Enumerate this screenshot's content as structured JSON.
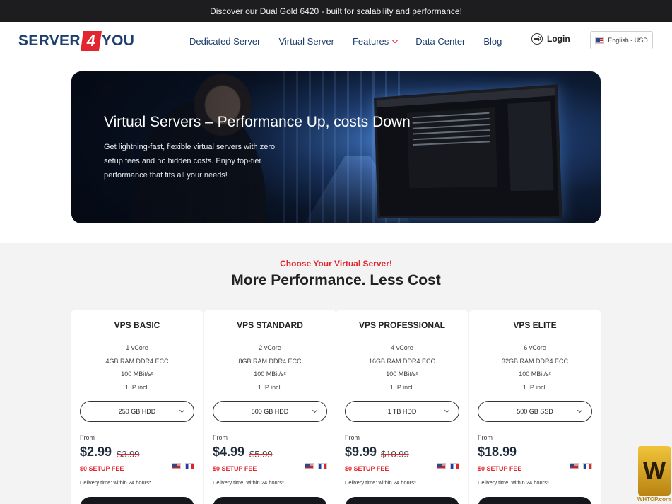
{
  "announcement": "Discover our Dual Gold 6420 - built for scalability and performance!",
  "logo": {
    "part1": "SERVER",
    "part2": "4",
    "part3": "YOU"
  },
  "nav": {
    "items": [
      "Dedicated Server",
      "Virtual Server",
      "Features",
      "Data Center",
      "Blog"
    ],
    "login": "Login",
    "language": "English - USD"
  },
  "hero": {
    "title": "Virtual Servers – Performance Up, costs Down",
    "text": "Get lightning-fast, flexible virtual servers with zero setup fees and no hidden costs. Enjoy top-tier performance that fits all your needs!"
  },
  "section": {
    "kicker": "Choose Your Virtual Server!",
    "title": "More Performance. Less Cost"
  },
  "plans": [
    {
      "name": "VPS BASIC",
      "specs": [
        "1 vCore",
        "4GB RAM DDR4 ECC",
        "100 MBit/s²",
        "1 IP incl."
      ],
      "storage": "250 GB HDD",
      "from": "From",
      "price": "$2.99",
      "old_price": "$3.99",
      "setup": "$0 SETUP FEE",
      "delivery": "Delivery time: within 24 hours*"
    },
    {
      "name": "VPS STANDARD",
      "specs": [
        "2 vCore",
        "8GB RAM DDR4 ECC",
        "100 MBit/s²",
        "1 IP incl."
      ],
      "storage": "500 GB HDD",
      "from": "From",
      "price": "$4.99",
      "old_price": "$5.99",
      "setup": "$0 SETUP FEE",
      "delivery": "Delivery time: within 24 hours*"
    },
    {
      "name": "VPS PROFESSIONAL",
      "specs": [
        "4 vCore",
        "16GB RAM DDR4 ECC",
        "100 MBit/s²",
        "1 IP incl."
      ],
      "storage": "1 TB HDD",
      "from": "From",
      "price": "$9.99",
      "old_price": "$10.99",
      "setup": "$0 SETUP FEE",
      "delivery": "Delivery time: within 24 hours*"
    },
    {
      "name": "VPS ELITE",
      "specs": [
        "6 vCore",
        "32GB RAM DDR4 ECC",
        "100 MBit/s²",
        "1 IP incl."
      ],
      "storage": "500 GB SSD",
      "from": "From",
      "price": "$18.99",
      "old_price": "",
      "setup": "$0 SETUP FEE",
      "delivery": "Delivery time: within 24 hours*"
    }
  ],
  "watermark": {
    "mark": "W",
    "site": "WHTOP.com"
  },
  "colors": {
    "accent": "#e2262f",
    "brand": "#1d3f6e",
    "dark": "#1d1d20"
  }
}
